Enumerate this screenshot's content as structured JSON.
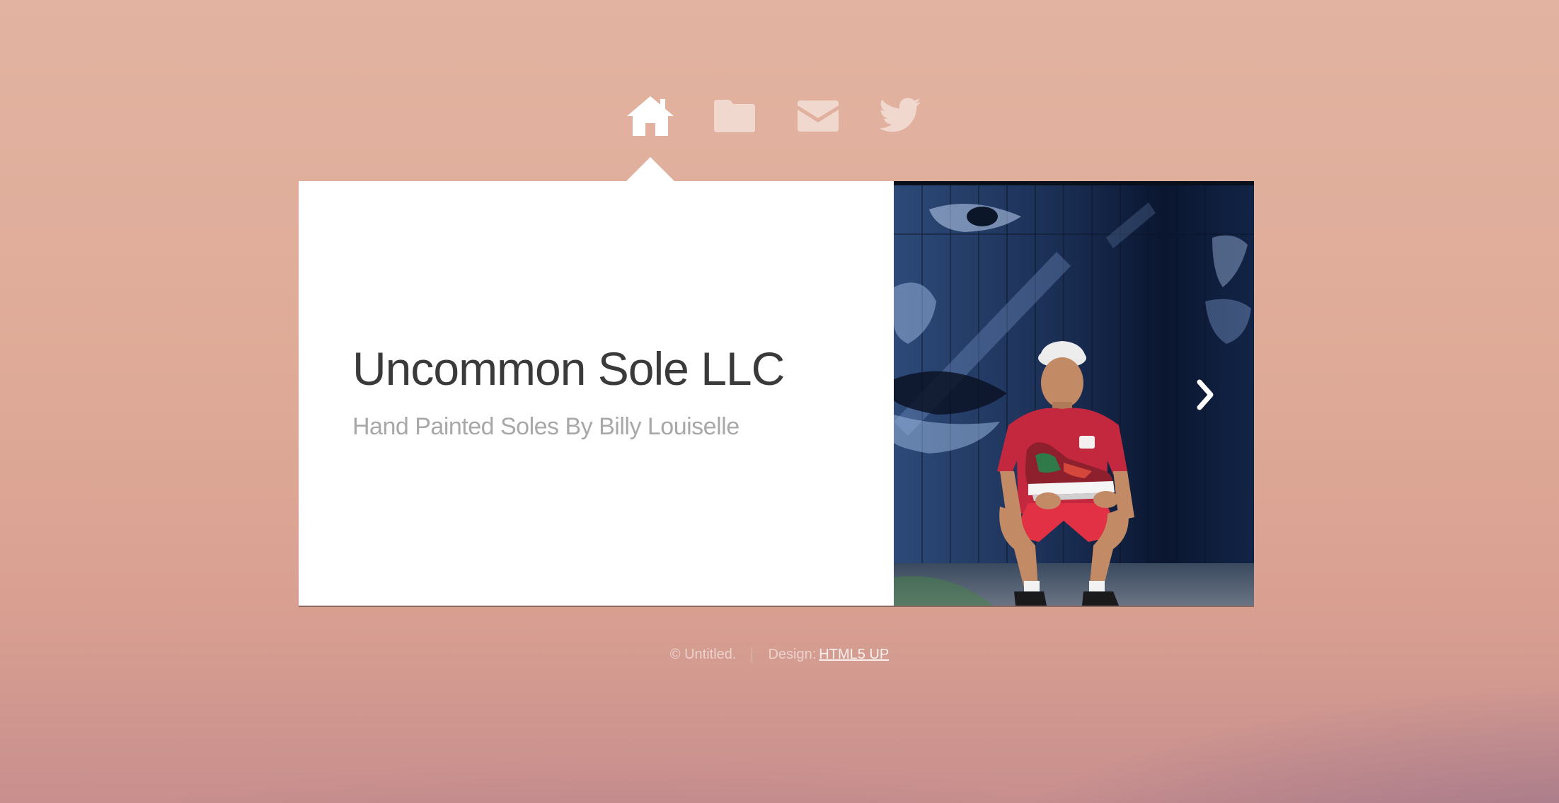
{
  "nav": {
    "items": [
      {
        "icon": "home-icon",
        "active": true
      },
      {
        "icon": "folder-icon",
        "active": false
      },
      {
        "icon": "envelope-icon",
        "active": false
      },
      {
        "icon": "twitter-icon",
        "active": false
      }
    ]
  },
  "panel": {
    "title": "Uncommon Sole LLC",
    "subtitle": "Hand Painted Soles By Billy Louiselle",
    "image_alt": "Young man in red shirt crouching in front of blue mural, holding a hand-painted high-top sneaker"
  },
  "footer": {
    "copyright": "© Untitled.",
    "design_label": "Design:",
    "design_link": "HTML5 UP"
  },
  "colors": {
    "panel_bg": "#ffffff",
    "title": "#3a3a3a",
    "subtitle": "#a8a8a8",
    "bg_top": "#e2b3a1",
    "bg_bottom_right": "#7a6a8e"
  }
}
